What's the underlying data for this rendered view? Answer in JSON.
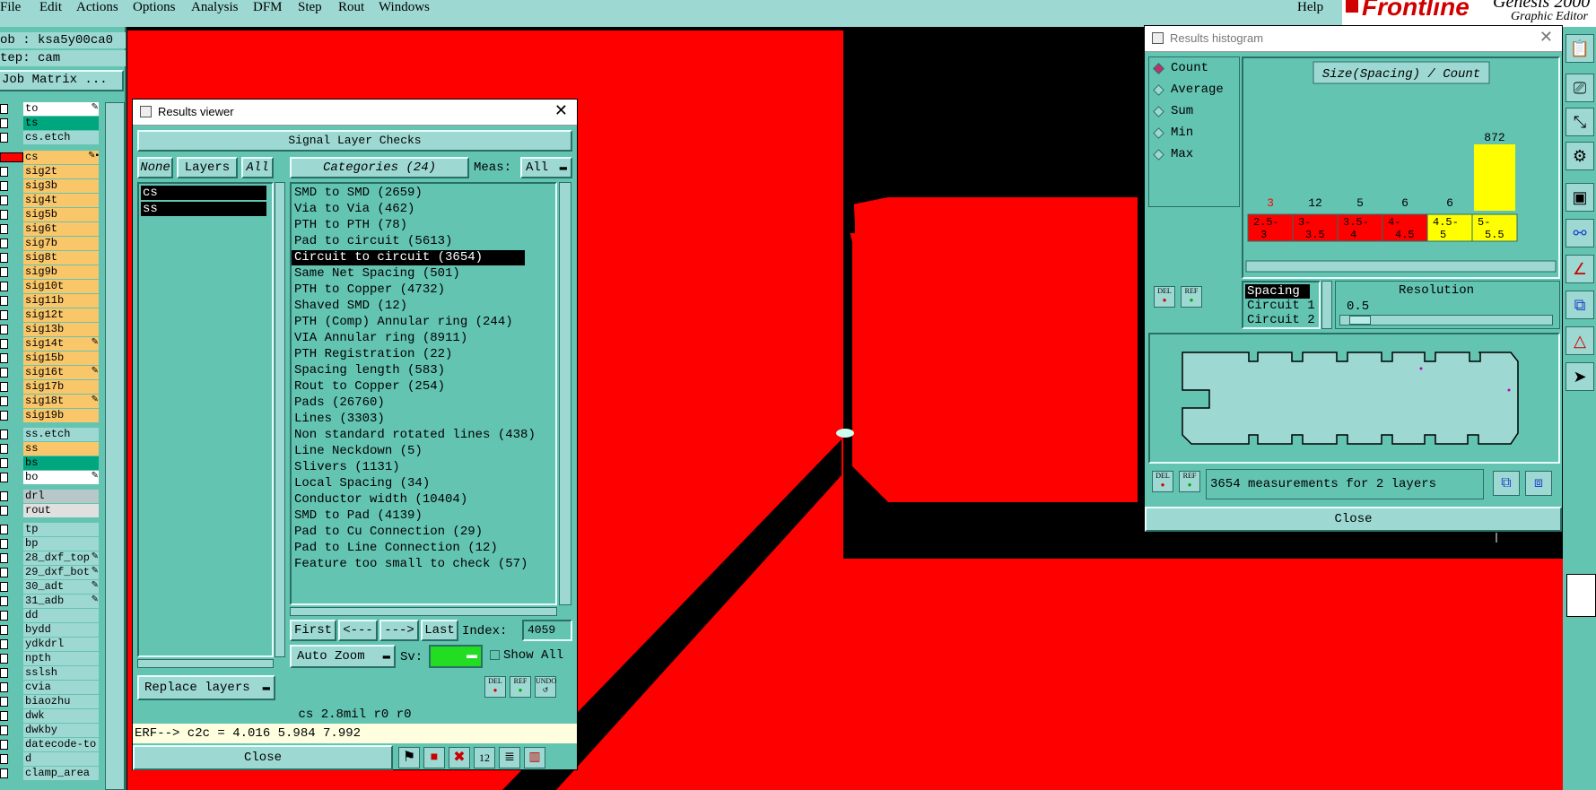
{
  "menubar": {
    "items": [
      "File",
      "Edit",
      "Actions",
      "Options",
      "Analysis",
      "DFM",
      "Step",
      "Rout",
      "Windows"
    ],
    "help": "Help",
    "brand": "Frontline",
    "product": "Genesis 2000",
    "subtitle": "Graphic Editor"
  },
  "leftpanel": {
    "job": "ob : ksa5y00ca0",
    "step": "tep: cam",
    "job_matrix": "Job Matrix ...",
    "layers": [
      {
        "name": "to",
        "color": "#ffffff",
        "mark": "✎"
      },
      {
        "name": "ts",
        "color": "#00a67e",
        "mark": ""
      },
      {
        "name": "cs.etch",
        "color": "#9dd9d2",
        "mark": ""
      },
      {
        "name": "cs",
        "color": "#f9c66a",
        "mark": "✎▪"
      },
      {
        "name": "sig2t",
        "color": "#f9c66a",
        "mark": ""
      },
      {
        "name": "sig3b",
        "color": "#f9c66a",
        "mark": ""
      },
      {
        "name": "sig4t",
        "color": "#f9c66a",
        "mark": ""
      },
      {
        "name": "sig5b",
        "color": "#f9c66a",
        "mark": ""
      },
      {
        "name": "sig6t",
        "color": "#f9c66a",
        "mark": ""
      },
      {
        "name": "sig7b",
        "color": "#f9c66a",
        "mark": ""
      },
      {
        "name": "sig8t",
        "color": "#f9c66a",
        "mark": ""
      },
      {
        "name": "sig9b",
        "color": "#f9c66a",
        "mark": ""
      },
      {
        "name": "sig10t",
        "color": "#f9c66a",
        "mark": ""
      },
      {
        "name": "sig11b",
        "color": "#f9c66a",
        "mark": ""
      },
      {
        "name": "sig12t",
        "color": "#f9c66a",
        "mark": ""
      },
      {
        "name": "sig13b",
        "color": "#f9c66a",
        "mark": ""
      },
      {
        "name": "sig14t",
        "color": "#f9c66a",
        "mark": "✎"
      },
      {
        "name": "sig15b",
        "color": "#f9c66a",
        "mark": ""
      },
      {
        "name": "sig16t",
        "color": "#f9c66a",
        "mark": "✎"
      },
      {
        "name": "sig17b",
        "color": "#f9c66a",
        "mark": ""
      },
      {
        "name": "sig18t",
        "color": "#f9c66a",
        "mark": "✎"
      },
      {
        "name": "sig19b",
        "color": "#f9c66a",
        "mark": ""
      },
      {
        "name": "ss.etch",
        "color": "#9dd9d2",
        "mark": ""
      },
      {
        "name": "ss",
        "color": "#f9c66a",
        "mark": ""
      },
      {
        "name": "bs",
        "color": "#00a67e",
        "mark": ""
      },
      {
        "name": "bo",
        "color": "#ffffff",
        "mark": "✎"
      },
      {
        "name": "drl",
        "color": "#b8c8c8",
        "mark": ""
      },
      {
        "name": "rout",
        "color": "#e0e0e0",
        "mark": ""
      },
      {
        "name": "tp",
        "color": "#9dd9d2",
        "mark": ""
      },
      {
        "name": "bp",
        "color": "#9dd9d2",
        "mark": ""
      },
      {
        "name": "28_dxf_top",
        "color": "#9dd9d2",
        "mark": "✎"
      },
      {
        "name": "29_dxf_bot",
        "color": "#9dd9d2",
        "mark": "✎"
      },
      {
        "name": "30_adt",
        "color": "#9dd9d2",
        "mark": "✎"
      },
      {
        "name": "31_adb",
        "color": "#9dd9d2",
        "mark": "✎"
      },
      {
        "name": "dd",
        "color": "#9dd9d2",
        "mark": ""
      },
      {
        "name": "bydd",
        "color": "#9dd9d2",
        "mark": ""
      },
      {
        "name": "ydkdrl",
        "color": "#9dd9d2",
        "mark": ""
      },
      {
        "name": "npth",
        "color": "#9dd9d2",
        "mark": ""
      },
      {
        "name": "sslsh",
        "color": "#9dd9d2",
        "mark": ""
      },
      {
        "name": "cvia",
        "color": "#9dd9d2",
        "mark": ""
      },
      {
        "name": "biaozhu",
        "color": "#9dd9d2",
        "mark": ""
      },
      {
        "name": "dwk",
        "color": "#9dd9d2",
        "mark": ""
      },
      {
        "name": "dwkby",
        "color": "#9dd9d2",
        "mark": ""
      },
      {
        "name": "datecode-to",
        "color": "#9dd9d2",
        "mark": ""
      },
      {
        "name": "d",
        "color": "#9dd9d2",
        "mark": ""
      },
      {
        "name": "clamp_area",
        "color": "#9dd9d2",
        "mark": ""
      }
    ]
  },
  "results_viewer": {
    "title": "Results viewer",
    "header": "Signal Layer Checks",
    "none_btn": "None",
    "layers_btn": "Layers",
    "all_btn": "All",
    "layers": [
      "cs",
      "ss"
    ],
    "categories_btn": "Categories (24)",
    "meas_label": "Meas:",
    "meas_value": "All",
    "categories": [
      "SMD to SMD (2659)",
      "Via to Via (462)",
      "PTH to PTH (78)",
      "Pad to circuit (5613)",
      "Circuit to circuit (3654)",
      "Same Net Spacing (501)",
      "PTH to Copper (4732)",
      "Shaved SMD (12)",
      "PTH (Comp) Annular ring (244)",
      "VIA Annular ring (8911)",
      "PTH Registration (22)",
      "Spacing length (583)",
      "Rout to Copper (254)",
      "Pads (26760)",
      "Lines (3303)",
      "Non standard rotated lines (438)",
      "Line Neckdown (5)",
      "Slivers (1131)",
      "Local Spacing (34)",
      "Conductor width (10404)",
      "SMD to Pad (4139)",
      "Pad to Cu Connection (29)",
      "Pad to Line Connection (12)",
      "Feature too small to check (57)"
    ],
    "selected_category": "Circuit to circuit (3654)",
    "nav": {
      "first": "First",
      "prev": "<---",
      "next": "--->",
      "last": "Last",
      "index_label": "Index:",
      "index_value": "4059"
    },
    "auto_zoom": "Auto Zoom",
    "sv_label": "Sv:",
    "show_all": "Show All",
    "replace_layers": "Replace layers",
    "del": "DEL",
    "ref": "REF",
    "undo": "UNDO",
    "status": "cs 2.8mil  r0  r0",
    "erf_line": "ERF--> c2c = 4.016 5.984 7.992",
    "close": "Close"
  },
  "histogram": {
    "title": "Results histogram",
    "modes": [
      "Count",
      "Average",
      "Sum",
      "Min",
      "Max"
    ],
    "selected_mode": "Count",
    "chart_title": "Size(Spacing) / Count",
    "del": "DEL",
    "ref": "REF",
    "sort_items": [
      "Spacing",
      "Circuit 1",
      "Circuit 2"
    ],
    "resolution_label": "Resolution",
    "resolution_value": "0.5",
    "measurements": "3654 measurements for 2 layers",
    "close": "Close",
    "colors": {
      "red": "#ff0000",
      "yellow": "#ffff00"
    }
  },
  "chart_data": {
    "type": "bar",
    "title": "Size(Spacing) / Count",
    "categories": [
      "2.5-3",
      "3-3.5",
      "3.5-4",
      "4-4.5",
      "4.5-5",
      "5-5.5"
    ],
    "category_labels": [
      [
        "2.5-",
        "3"
      ],
      [
        "3-",
        "3.5"
      ],
      [
        "3.5-",
        "4"
      ],
      [
        "4-",
        "4.5"
      ],
      [
        "4.5-",
        "5"
      ],
      [
        "5-",
        "5.5"
      ]
    ],
    "values": [
      3,
      12,
      5,
      6,
      6,
      872
    ],
    "bar_colors": [
      "#ff0000",
      "#ff0000",
      "#ff0000",
      "#ff0000",
      "#ffff00",
      "#ffff00"
    ],
    "value_label_colors": [
      "#ff0000",
      "#000000",
      "#000000",
      "#000000",
      "#000000",
      "#000000"
    ]
  }
}
